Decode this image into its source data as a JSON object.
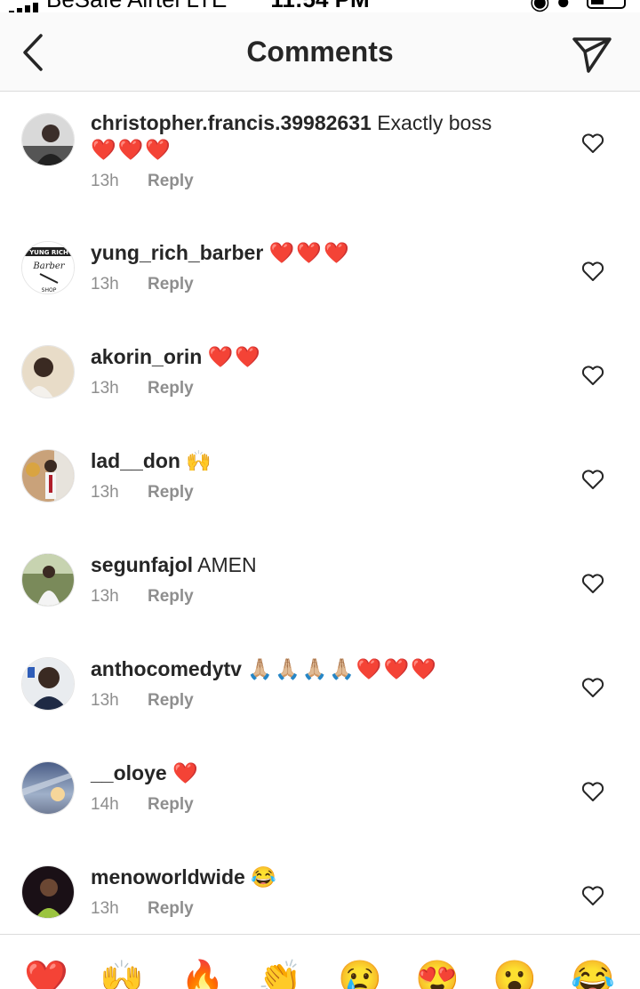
{
  "status": {
    "carrier": "BeSafe Airtel  LTE",
    "time": "11:54 PM"
  },
  "header": {
    "title": "Comments"
  },
  "comments": [
    {
      "user": "christopher.francis.39982631",
      "text": "Exactly boss",
      "emoji": "❤️❤️❤️",
      "time": "13h",
      "reply": "Reply"
    },
    {
      "user": "yung_rich_barber",
      "text": "",
      "emoji": "❤️❤️❤️",
      "time": "13h",
      "reply": "Reply"
    },
    {
      "user": "akorin_orin",
      "text": "",
      "emoji": "❤️❤️",
      "time": "13h",
      "reply": "Reply"
    },
    {
      "user": "lad__don",
      "text": "",
      "emoji": "🙌",
      "time": "13h",
      "reply": "Reply"
    },
    {
      "user": "segunfajol",
      "text": "AMEN",
      "emoji": "",
      "time": "13h",
      "reply": "Reply"
    },
    {
      "user": "anthocomedytv",
      "text": "",
      "emoji": "🙏🏼🙏🏼🙏🏼🙏🏼❤️❤️❤️",
      "time": "13h",
      "reply": "Reply"
    },
    {
      "user": "__oloye",
      "text": "",
      "emoji": "❤️",
      "time": "14h",
      "reply": "Reply"
    },
    {
      "user": "menoworldwide",
      "text": "",
      "emoji": "😂",
      "time": "13h",
      "reply": "Reply"
    }
  ],
  "avatars": {
    "yung_rich_barber": {
      "top": "YUNG RICH",
      "script": "Barber",
      "bottom": "SHOP"
    }
  },
  "emoji_bar": [
    "❤️",
    "🙌",
    "🔥",
    "👏",
    "😢",
    "😍",
    "😮",
    "😂"
  ],
  "colors": {
    "text": "#262626",
    "meta": "#8e8e8e",
    "heart": "#e0242f",
    "divider": "#dbdbdb"
  },
  "icons": {
    "back": "chevron-left-icon",
    "send": "paper-plane-icon",
    "like": "heart-outline-icon"
  }
}
